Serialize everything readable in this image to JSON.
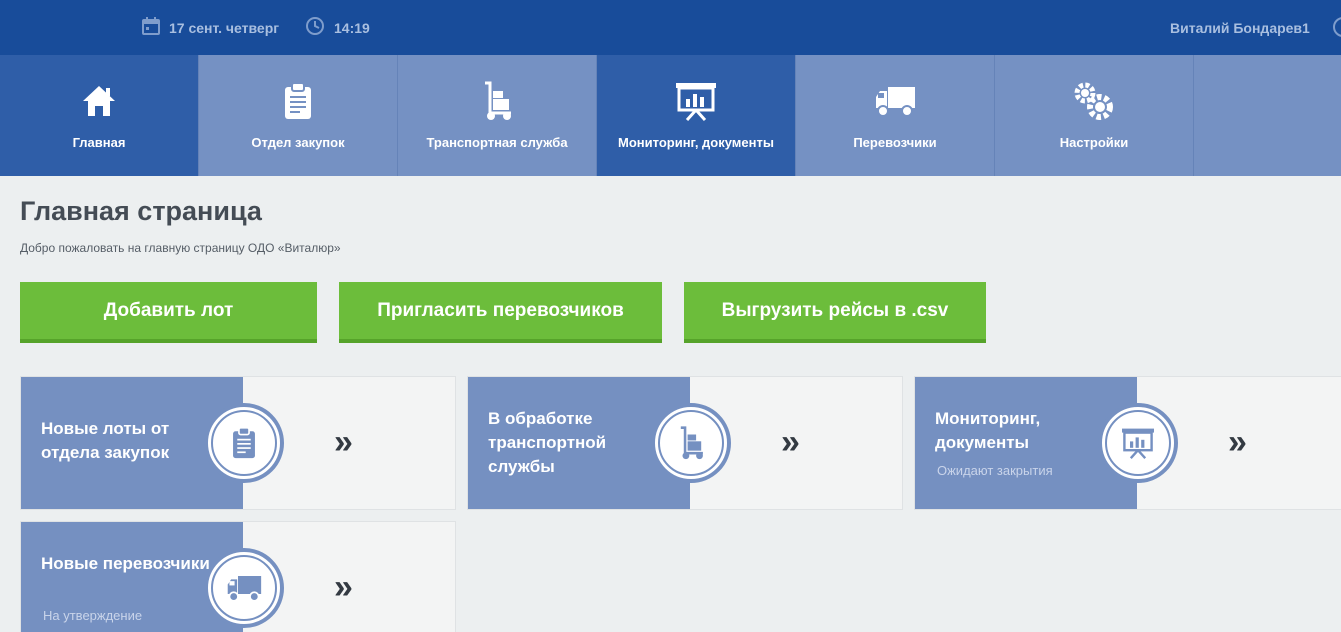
{
  "topbar": {
    "date": "17 сент. четверг",
    "time": "14:19",
    "user": "Виталий Бондарев1",
    "icons": [
      "calendar-icon",
      "clock-icon",
      "power-icon"
    ]
  },
  "nav": {
    "tabs": [
      {
        "label": "Главная",
        "icon": "home-icon"
      },
      {
        "label": "Отдел закупок",
        "icon": "clipboard-icon"
      },
      {
        "label": "Транспортная служба",
        "icon": "hand-truck-icon"
      },
      {
        "label": "Мониторинг, документы",
        "icon": "presentation-chart-icon"
      },
      {
        "label": "Перевозчики",
        "icon": "truck-icon"
      },
      {
        "label": "Настройки",
        "icon": "gears-icon"
      }
    ]
  },
  "page": {
    "title": "Главная страница",
    "subtitle": "Добро пожаловать на главную страницу ОДО «Виталюр»"
  },
  "actions": {
    "add_lot": "Добавить лот",
    "invite_carriers": "Пригласить перевозчиков",
    "export_csv": "Выгрузить рейсы в .csv"
  },
  "cards": [
    {
      "title": "Новые лоты от отдела закупок",
      "sub": "",
      "icon": "clipboard-icon",
      "arrow": "»"
    },
    {
      "title": "В обработке транспортной службы",
      "sub": "",
      "icon": "hand-truck-icon",
      "arrow": "»"
    },
    {
      "title": "Мониторинг, документы",
      "sub": "Ожидают закрытия",
      "icon": "presentation-chart-icon",
      "arrow": "»"
    },
    {
      "title": "Новые перевозчики",
      "sub": "На утверждение",
      "icon": "truck-icon",
      "arrow": "»"
    }
  ],
  "colors": {
    "topbar": "#184c9a",
    "nav": "#7591c3",
    "nav_active": "#2f5ea8",
    "button": "#6cbd3b",
    "card_side": "#7590c1"
  }
}
